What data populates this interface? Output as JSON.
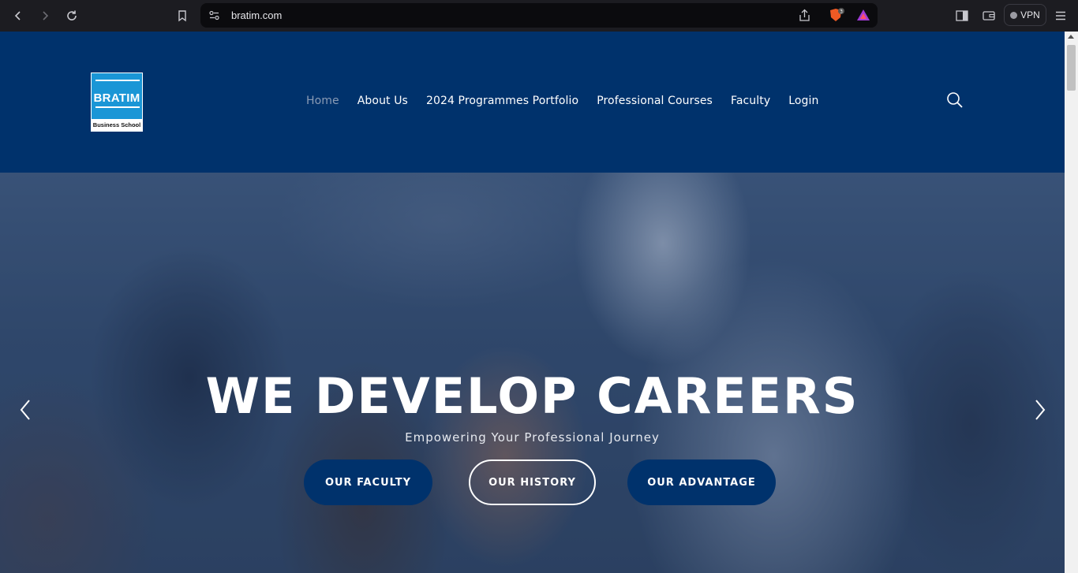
{
  "browser": {
    "url": "bratim.com",
    "vpn_label": "VPN",
    "shield_badge": "3"
  },
  "site": {
    "logo": {
      "name": "BRATIM",
      "tagline": "Business School"
    },
    "nav": [
      {
        "label": "Home",
        "active": true
      },
      {
        "label": "About Us"
      },
      {
        "label": "2024 Programmes Portfolio"
      },
      {
        "label": "Professional Courses"
      },
      {
        "label": "Faculty"
      },
      {
        "label": "Login"
      }
    ]
  },
  "hero": {
    "title": "WE DEVELOP CAREERS",
    "subtitle": "Empowering Your Professional Journey",
    "buttons": [
      {
        "label": "OUR FACULTY",
        "style": "solid"
      },
      {
        "label": "OUR HISTORY",
        "style": "outline"
      },
      {
        "label": "OUR ADVANTAGE",
        "style": "solid"
      }
    ]
  },
  "colors": {
    "brand_navy": "#00326c",
    "logo_blue": "#1a96d6"
  }
}
